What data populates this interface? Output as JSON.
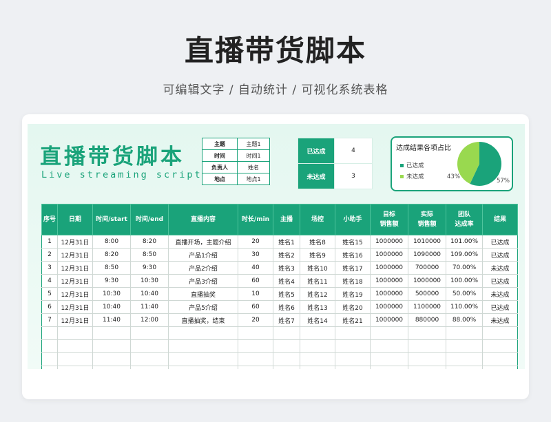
{
  "page": {
    "title": "直播带货脚本",
    "subtitle": "可编辑文字 / 自动统计 / 可视化系统表格"
  },
  "sheet": {
    "title_cn": "直播带货脚本",
    "title_en": "Live streaming scripts",
    "info": [
      {
        "key": "主题",
        "value": "主题1"
      },
      {
        "key": "时间",
        "value": "时间1"
      },
      {
        "key": "负责人",
        "value": "姓名"
      },
      {
        "key": "地点",
        "value": "地点1"
      }
    ],
    "status": [
      {
        "label": "已达成",
        "count": "4"
      },
      {
        "label": "未达成",
        "count": "3"
      }
    ],
    "pie": {
      "title": "达成结果各项占比",
      "legend": [
        "已达成",
        "未达成"
      ],
      "achieved_pct": "57%",
      "unachieved_pct": "43%",
      "colors": {
        "achieved": "#1aa37a",
        "unachieved": "#99d94f"
      }
    },
    "columns": [
      "序号",
      "日期",
      "时间/start",
      "时间/end",
      "直播内容",
      "时长/min",
      "主播",
      "场控",
      "小助手",
      "目标\n销售额",
      "实际\n销售额",
      "团队\n达成率",
      "结果"
    ],
    "rows": [
      [
        "1",
        "12月31日",
        "8:00",
        "8:20",
        "直播开场，主题介绍",
        "20",
        "姓名1",
        "姓名8",
        "姓名15",
        "1000000",
        "1010000",
        "101.00%",
        "已达成"
      ],
      [
        "2",
        "12月31日",
        "8:20",
        "8:50",
        "产品1介绍",
        "30",
        "姓名2",
        "姓名9",
        "姓名16",
        "1000000",
        "1090000",
        "109.00%",
        "已达成"
      ],
      [
        "3",
        "12月31日",
        "8:50",
        "9:30",
        "产品2介绍",
        "40",
        "姓名3",
        "姓名10",
        "姓名17",
        "1000000",
        "700000",
        "70.00%",
        "未达成"
      ],
      [
        "4",
        "12月31日",
        "9:30",
        "10:30",
        "产品3介绍",
        "60",
        "姓名4",
        "姓名11",
        "姓名18",
        "1000000",
        "1000000",
        "100.00%",
        "已达成"
      ],
      [
        "5",
        "12月31日",
        "10:30",
        "10:40",
        "直播抽奖",
        "10",
        "姓名5",
        "姓名12",
        "姓名19",
        "1000000",
        "500000",
        "50.00%",
        "未达成"
      ],
      [
        "6",
        "12月31日",
        "10:40",
        "11:40",
        "产品5介绍",
        "60",
        "姓名6",
        "姓名13",
        "姓名20",
        "1000000",
        "1100000",
        "110.00%",
        "已达成"
      ],
      [
        "7",
        "12月31日",
        "11:40",
        "12:00",
        "直播抽奖，结束",
        "20",
        "姓名7",
        "姓名14",
        "姓名21",
        "1000000",
        "880000",
        "88.00%",
        "未达成"
      ]
    ],
    "empty_rows": 4
  }
}
